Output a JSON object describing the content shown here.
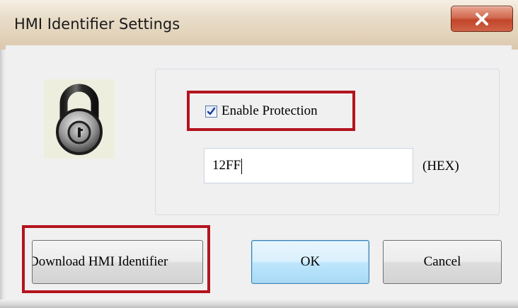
{
  "window": {
    "title": "HMI Identifier Settings",
    "close_icon": "close-x-icon"
  },
  "protection": {
    "checkbox_label": "Enable Protection",
    "checked": true,
    "password_value": "12FF",
    "format_label": "(HEX)",
    "lock_icon": "padlock-icon"
  },
  "buttons": {
    "download_label": "Download HMI Identifier",
    "ok_label": "OK",
    "cancel_label": "Cancel"
  },
  "colors": {
    "highlight": "#b4141e",
    "ok_accent": "#3c7fb1",
    "close_button": "#c2452a"
  }
}
